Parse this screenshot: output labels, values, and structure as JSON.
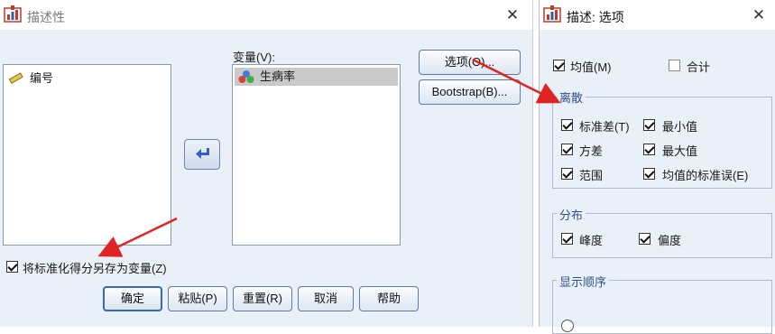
{
  "left_dialog": {
    "title": "描述性",
    "close": "✕",
    "source_list": [
      {
        "label": "编号",
        "icon": "ruler-icon"
      }
    ],
    "variables_label": "变量(V):",
    "selected_variables": [
      {
        "label": "生病率",
        "icon": "nominal-variable-icon"
      }
    ],
    "buttons": {
      "options": "选项(O)...",
      "bootstrap": "Bootstrap(B)..."
    },
    "save_standardized": {
      "label": "将标准化得分另存为变量(Z)",
      "checked": true
    },
    "footer": {
      "ok": "确定",
      "paste": "粘贴(P)",
      "reset": "重置(R)",
      "cancel": "取消",
      "help": "帮助"
    }
  },
  "right_dialog": {
    "title": "描述: 选项",
    "close": "✕",
    "mean": {
      "label": "均值(M)",
      "checked": true
    },
    "sum": {
      "label": "合计",
      "checked": false
    },
    "dispersion": {
      "title": "离散",
      "std_dev": {
        "label": "标准差(T)",
        "checked": true
      },
      "minimum": {
        "label": "最小值",
        "checked": true
      },
      "variance": {
        "label": "方差",
        "checked": true
      },
      "maximum": {
        "label": "最大值",
        "checked": true
      },
      "range": {
        "label": "范围",
        "checked": true
      },
      "se_mean": {
        "label": "均值的标准误(E)",
        "checked": true
      }
    },
    "distribution": {
      "title": "分布",
      "kurtosis": {
        "label": "峰度",
        "checked": true
      },
      "skewness": {
        "label": "偏度",
        "checked": true
      }
    },
    "display_order": {
      "title": "显示顺序"
    }
  },
  "colors": {
    "arrow": "#e02424",
    "selection": "#c9c9c9",
    "window_bg": "#eaf0f7",
    "accent": "#3a68b8"
  }
}
